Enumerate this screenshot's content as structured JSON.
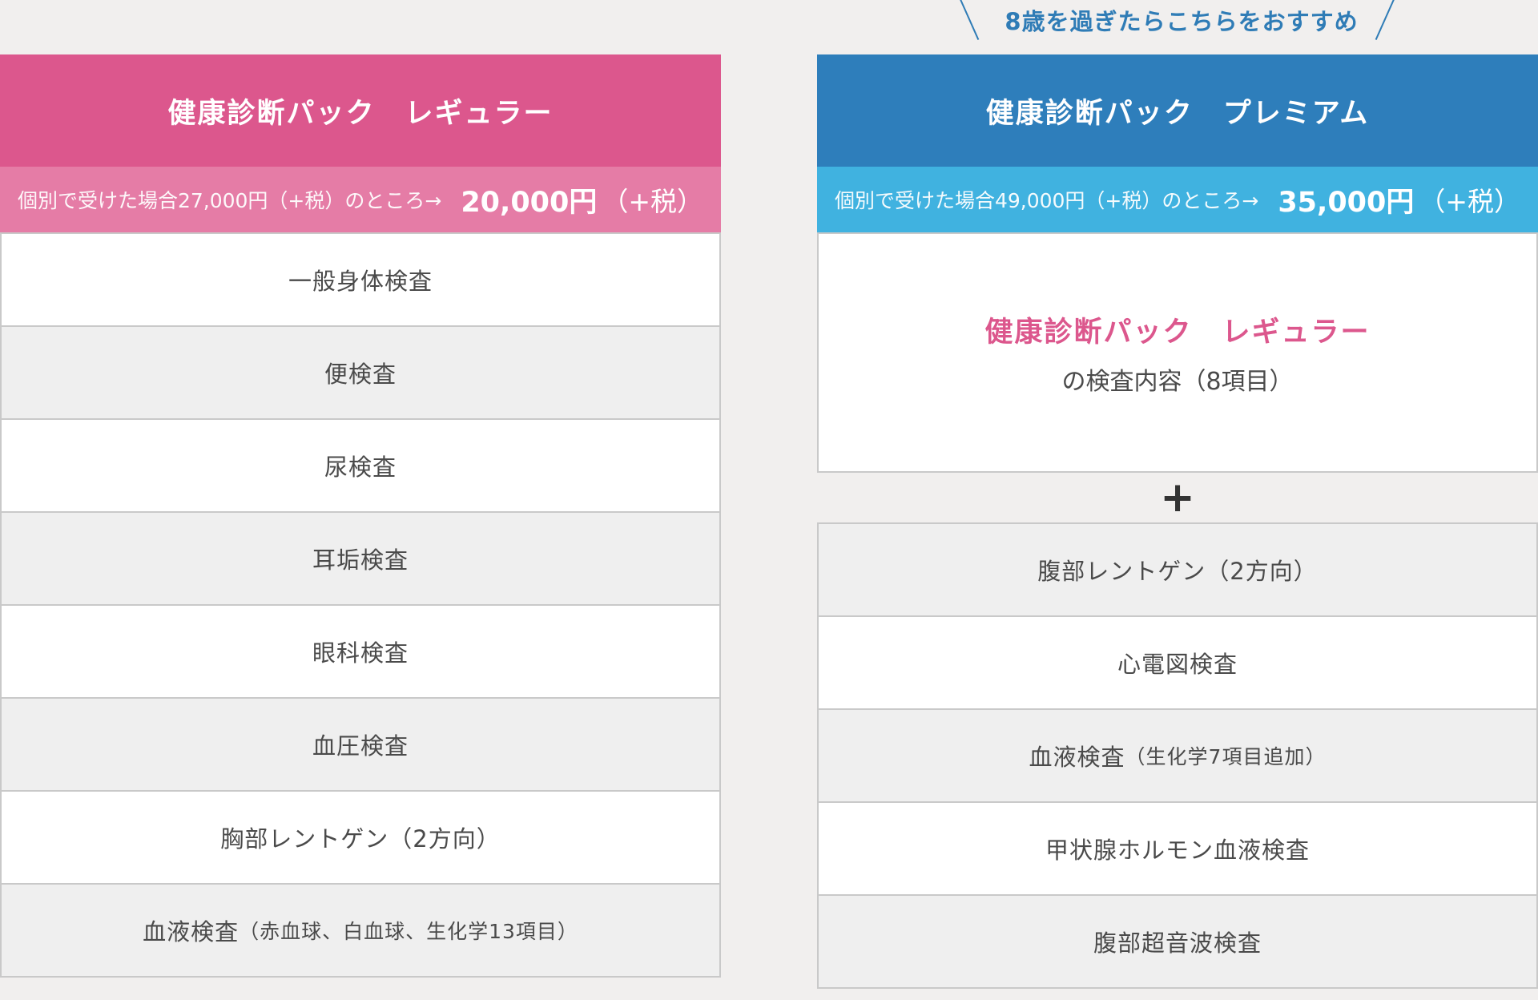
{
  "recommend": {
    "text": "8歳を過ぎたらこちらをおすすめ"
  },
  "regular": {
    "title": "健康診断パック　レギュラー",
    "price_note": "個別で受けた場合27,000円（+税）のところ→",
    "price": "20,000円",
    "tax": "（+税）",
    "items": [
      "一般身体検査",
      "便検査",
      "尿検査",
      "耳垢検査",
      "眼科検査",
      "血圧検査",
      "胸部レントゲン（2方向）"
    ],
    "last_item_main": "血液検査",
    "last_item_detail": "（赤血球、白血球、生化学13項目）"
  },
  "premium": {
    "title": "健康診断パック　プレミアム",
    "price_note": "個別で受けた場合49,000円（+税）のところ→",
    "price": "35,000円",
    "tax": "（+税）",
    "summary_title": "健康診断パック　レギュラー",
    "summary_sub": "の検査内容（8項目）",
    "plus": "+",
    "items": [
      "腹部レントゲン（2方向）",
      "心電図検査"
    ],
    "blood_main": "血液検査",
    "blood_detail": "（生化学7項目追加）",
    "items2": [
      "甲状腺ホルモン血液検査",
      "腹部超音波検査"
    ]
  }
}
